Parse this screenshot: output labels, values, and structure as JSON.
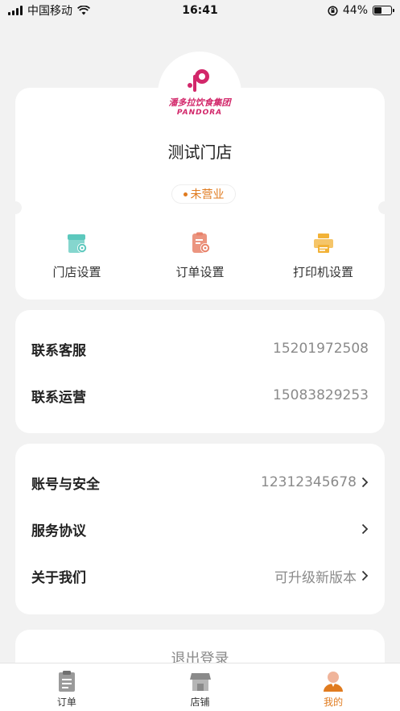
{
  "status_bar": {
    "carrier": "中国移动",
    "time": "16:41",
    "battery_percent": "44%",
    "battery_level": 0.44
  },
  "store": {
    "logo_cn": "潘多拉饮食集团",
    "logo_en": "PANDORA",
    "name": "测试门店",
    "status": "未营业",
    "status_color": "#e07b1f",
    "actions": [
      {
        "label": "门店设置",
        "icon": "store-settings-icon",
        "color": "#5cc8bd"
      },
      {
        "label": "订单设置",
        "icon": "order-settings-icon",
        "color": "#e8826a"
      },
      {
        "label": "打印机设置",
        "icon": "printer-icon",
        "color": "#f2b237"
      }
    ]
  },
  "contacts": [
    {
      "label": "联系客服",
      "value": "15201972508"
    },
    {
      "label": "联系运营",
      "value": "15083829253"
    }
  ],
  "settings": [
    {
      "label": "账号与安全",
      "value": "12312345678"
    },
    {
      "label": "服务协议",
      "value": ""
    },
    {
      "label": "关于我们",
      "value": "可升级新版本"
    }
  ],
  "logout_label": "退出登录",
  "tabs": [
    {
      "label": "订单",
      "icon": "order-icon",
      "active": false
    },
    {
      "label": "店铺",
      "icon": "shop-icon",
      "active": false
    },
    {
      "label": "我的",
      "icon": "profile-icon",
      "active": true
    }
  ],
  "colors": {
    "accent": "#e07b1f",
    "brand": "#d2276a",
    "background": "#f2f2f2"
  }
}
